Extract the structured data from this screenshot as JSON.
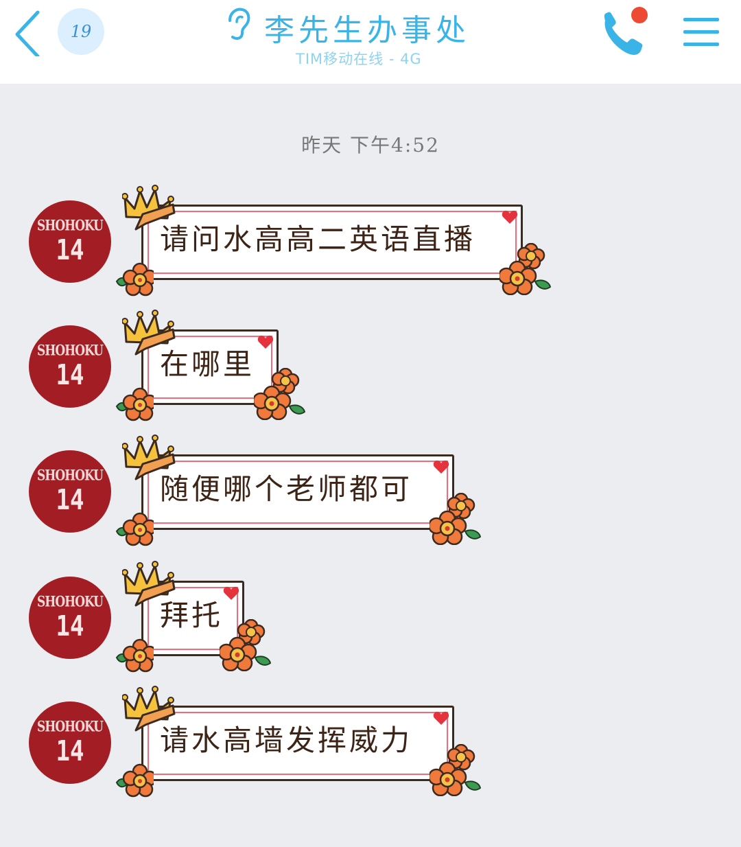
{
  "header": {
    "badge_count": "19",
    "title": "李先生办事处",
    "subtitle": "TIM移动在线 - 4G",
    "accent": "#3ab4e6",
    "notify_dot": "#ec4a32"
  },
  "chat": {
    "timestamp": "昨天 下午4:52",
    "avatar": {
      "team": "SHOHOKU",
      "number": "14",
      "color": "#a21e24"
    },
    "messages": [
      {
        "text": "请问水高高二英语直播"
      },
      {
        "text": "在哪里"
      },
      {
        "text": "随便哪个老师都可"
      },
      {
        "text": "拜托"
      },
      {
        "text": "请水高墙发挥威力"
      }
    ]
  }
}
